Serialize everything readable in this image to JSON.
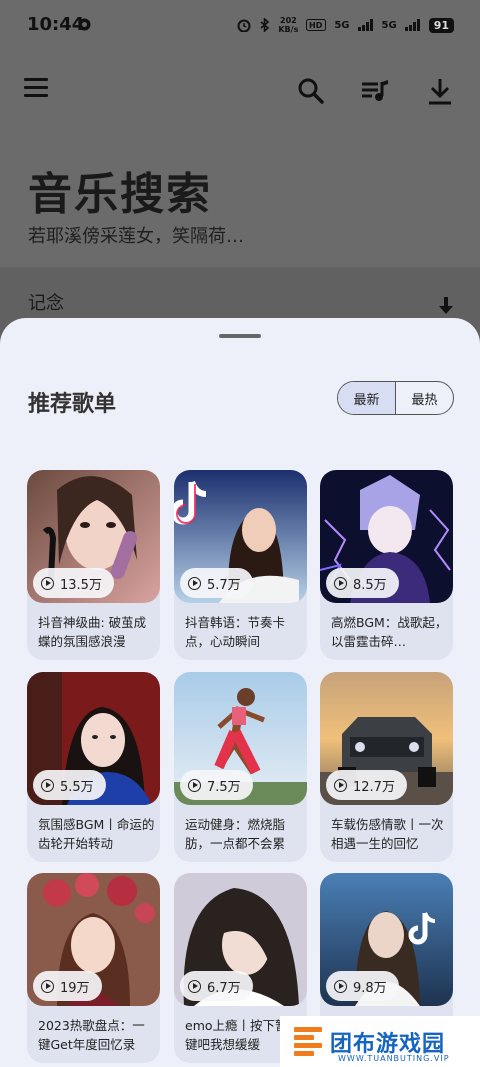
{
  "status": {
    "time": "10:44",
    "speed": "202\nKB/s",
    "net1": "5G",
    "net2": "5G",
    "battery": "91"
  },
  "header": {
    "title": "音乐搜索",
    "subtitle": "若耶溪傍采莲女，笑隔荷…"
  },
  "strip": {
    "title": "记念"
  },
  "section": {
    "title": "推荐歌单",
    "tab_new": "最新",
    "tab_hot": "最热"
  },
  "playlists": [
    {
      "plays": "13.5万",
      "title": "抖音神级曲: 破茧成蝶的氛围感浪漫"
    },
    {
      "plays": "5.7万",
      "title": "抖音韩语：节奏卡点，心动瞬间"
    },
    {
      "plays": "8.5万",
      "title": "高燃BGM：战歌起，以雷霆击碎…"
    },
    {
      "plays": "5.5万",
      "title": "氛围感BGM丨命运的齿轮开始转动"
    },
    {
      "plays": "7.5万",
      "title": "运动健身：燃烧脂肪，一点都不会累"
    },
    {
      "plays": "12.7万",
      "title": "车载伤感情歌丨一次相遇一生的回忆"
    },
    {
      "plays": "19万",
      "title": "2023热歌盘点：一键Get年度回忆录"
    },
    {
      "plays": "6.7万",
      "title": "emo上瘾丨按下暂停键吧我想缓缓"
    },
    {
      "plays": "9.8万",
      "title": ""
    }
  ],
  "watermark": {
    "name": "团布游戏园",
    "url": "WWW.TUANBUTING.VIP"
  },
  "colors": {
    "sheet": "#eef0f9",
    "card": "#dfe3ef",
    "segment_active": "#d7def3",
    "watermark_blue": "#1565c0",
    "watermark_orange": "#f07d1c"
  }
}
